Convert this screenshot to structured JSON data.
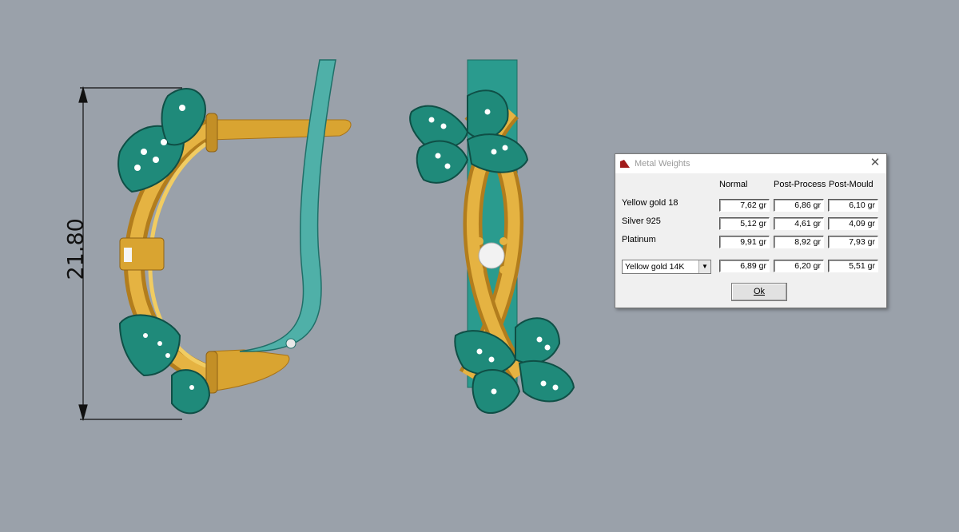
{
  "viewport": {
    "dimension_label": "21.80",
    "colors": {
      "background": "#9aa1aa",
      "gold": "#d9a431",
      "teal": "#1f8a7a",
      "hook": "#4fb0a8"
    }
  },
  "dialog": {
    "title": "Metal Weights",
    "close_glyph": "✕",
    "columns": [
      "Normal",
      "Post-Process",
      "Post-Mould"
    ],
    "rows": [
      {
        "label": "Yellow gold 18",
        "values": [
          "7,62 gr",
          "6,86 gr",
          "6,10 gr"
        ]
      },
      {
        "label": "Silver 925",
        "values": [
          "5,12 gr",
          "4,61 gr",
          "4,09 gr"
        ]
      },
      {
        "label": "Platinum",
        "values": [
          "9,91 gr",
          "8,92 gr",
          "7,93 gr"
        ]
      }
    ],
    "custom_metal": {
      "selected": "Yellow gold 14K",
      "values": [
        "6,89 gr",
        "6,20 gr",
        "5,51 gr"
      ]
    },
    "ok_label": "Ok"
  }
}
